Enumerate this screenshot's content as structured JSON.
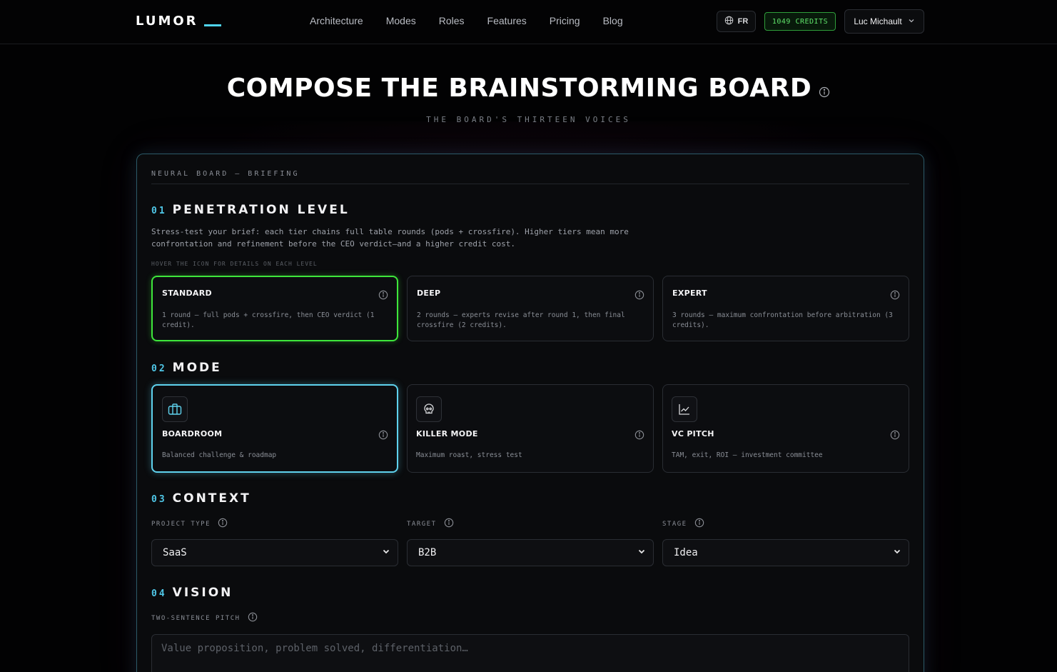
{
  "nav": {
    "logo": "LUMOR",
    "links": [
      "Architecture",
      "Modes",
      "Roles",
      "Features",
      "Pricing",
      "Blog"
    ],
    "lang": "FR",
    "credits": "1049 CREDITS",
    "user": "Luc Michault"
  },
  "hero": {
    "title": "COMPOSE THE BRAINSTORMING BOARD",
    "subtitle": "THE BOARD'S THIRTEEN VOICES"
  },
  "panel": {
    "header": "NEURAL BOARD — BRIEFING",
    "penetration": {
      "num": "01",
      "title": "PENETRATION LEVEL",
      "description": "Stress-test your brief: each tier chains full table rounds (pods + crossfire). Higher tiers mean more confrontation and refinement before the CEO verdict—and a higher credit cost.",
      "hint": "HOVER THE ICON FOR DETAILS ON EACH LEVEL",
      "levels": [
        {
          "title": "STANDARD",
          "desc": "1 round — full pods + crossfire, then CEO verdict (1 credit).",
          "selected": true
        },
        {
          "title": "DEEP",
          "desc": "2 rounds — experts revise after round 1, then final crossfire (2 credits).",
          "selected": false
        },
        {
          "title": "EXPERT",
          "desc": "3 rounds — maximum confrontation before arbitration (3 credits).",
          "selected": false
        }
      ]
    },
    "mode": {
      "num": "02",
      "title": "MODE",
      "modes": [
        {
          "title": "BOARDROOM",
          "desc": "Balanced challenge & roadmap",
          "icon": "briefcase-icon",
          "selected": true
        },
        {
          "title": "KILLER MODE",
          "desc": "Maximum roast, stress test",
          "icon": "skull-icon",
          "selected": false
        },
        {
          "title": "VC PITCH",
          "desc": "TAM, exit, ROI — investment committee",
          "icon": "line-chart-icon",
          "selected": false
        }
      ]
    },
    "context": {
      "num": "03",
      "title": "CONTEXT",
      "fields": [
        {
          "label": "PROJECT TYPE",
          "value": "SaaS"
        },
        {
          "label": "TARGET",
          "value": "B2B"
        },
        {
          "label": "STAGE",
          "value": "Idea"
        }
      ]
    },
    "vision": {
      "num": "04",
      "title": "VISION",
      "label": "TWO-SENTENCE PITCH",
      "placeholder": "Value proposition, problem solved, differentiation…"
    }
  },
  "colors": {
    "accent_cyan": "#4fc6e6",
    "accent_green": "#3ee63b",
    "background": "#020203"
  }
}
